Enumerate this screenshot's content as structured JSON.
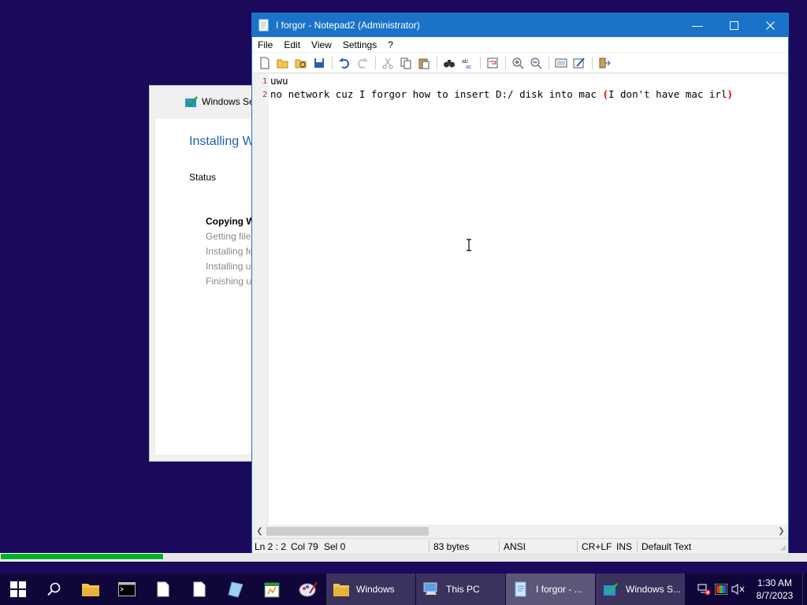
{
  "setup": {
    "title": "Windows Se",
    "heading": "Installing W",
    "status_label": "Status",
    "steps": [
      "Copying W",
      "Getting file",
      "Installing fe",
      "Installing u",
      "Finishing u"
    ]
  },
  "notepad": {
    "title": "I forgor - Notepad2 (Administrator)",
    "menu": [
      "File",
      "Edit",
      "View",
      "Settings",
      "?"
    ],
    "lines": [
      {
        "num": "1",
        "text": "uwu"
      },
      {
        "num": "2",
        "pre": "no network cuz I forgor how to insert D:/ disk into mac ",
        "paren_open": "(",
        "inner": "I don't have mac irl",
        "paren_close": ")"
      }
    ],
    "status": {
      "position": "Ln 2 : 2",
      "col": "Col 79",
      "sel": "Sel 0",
      "size": "83 bytes",
      "encoding": "ANSI",
      "eol": "CR+LF",
      "mode": "INS",
      "scheme": "Default Text"
    }
  },
  "progress": {
    "fraction": 0.203,
    "color": "#06b025"
  },
  "taskbar": {
    "tasks": [
      {
        "label": "Windows",
        "icon": "folder-icon"
      },
      {
        "label": "This PC",
        "icon": "computer-icon"
      },
      {
        "label": "I forgor - ...",
        "icon": "notepad-icon",
        "active": true
      },
      {
        "label": "Windows S...",
        "icon": "setup-icon"
      }
    ],
    "clock_time": "1:30 AM",
    "clock_date": "8/7/2023"
  },
  "colors": {
    "accent": "#1a73c8",
    "desktop": "#1b0a5c"
  }
}
